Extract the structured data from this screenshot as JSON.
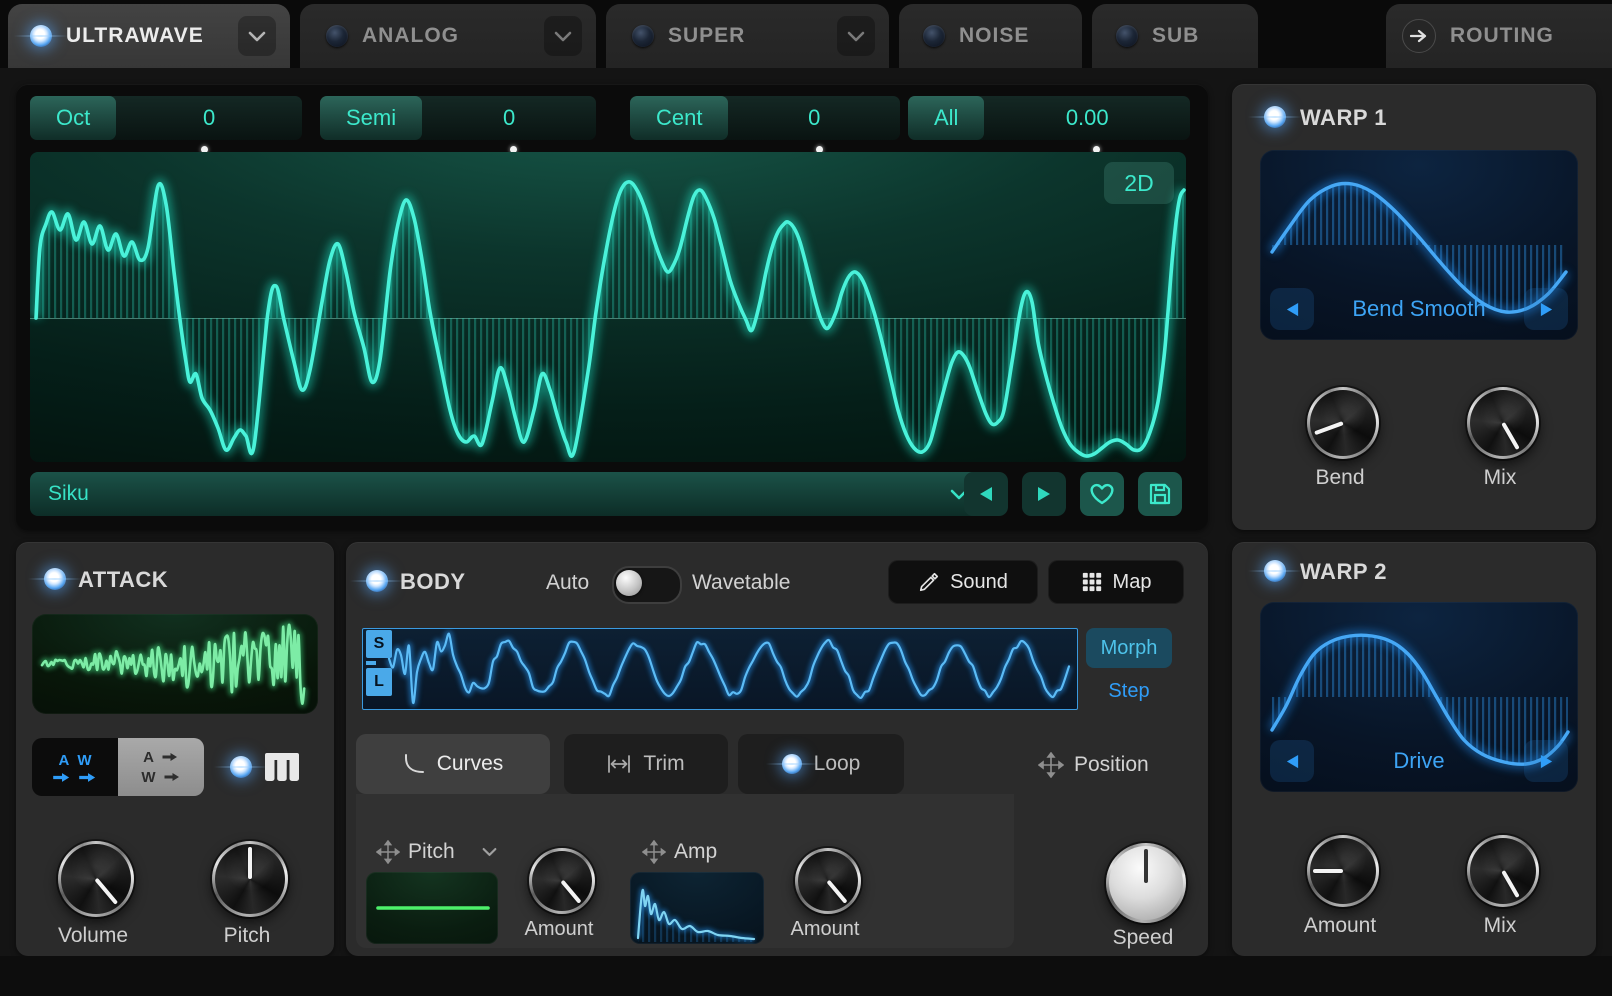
{
  "tabs": {
    "items": [
      {
        "label": "ULTRAWAVE",
        "active": true,
        "led": "on",
        "chevron": true
      },
      {
        "label": "ANALOG",
        "active": false,
        "led": "off",
        "chevron": true
      },
      {
        "label": "SUPER",
        "active": false,
        "led": "off",
        "chevron": true
      },
      {
        "label": "NOISE",
        "active": false,
        "led": "off",
        "chevron": false
      },
      {
        "label": "SUB",
        "active": false,
        "led": "off",
        "chevron": false
      }
    ],
    "routing_label": "ROUTING"
  },
  "oscillator": {
    "tune_controls": [
      {
        "label": "Oct",
        "value": "0"
      },
      {
        "label": "Semi",
        "value": "0"
      },
      {
        "label": "Cent",
        "value": "0"
      },
      {
        "label": "All",
        "value": "0.00"
      }
    ],
    "view_mode": "2D",
    "wavetable_name": "Siku"
  },
  "warp1": {
    "title": "WARP 1",
    "led": "on",
    "mode": "Bend Smooth",
    "knobs": [
      {
        "label": "Bend",
        "angle": -110
      },
      {
        "label": "Mix",
        "angle": 150
      }
    ]
  },
  "warp2": {
    "title": "WARP 2",
    "led": "on",
    "mode": "Drive",
    "knobs": [
      {
        "label": "Amount",
        "angle": -90
      },
      {
        "label": "Mix",
        "angle": 150
      }
    ]
  },
  "attack": {
    "title": "ATTACK",
    "led": "on",
    "keytrack_led": "on",
    "route_parallel": {
      "a": "A",
      "w": "W"
    },
    "route_serial": {
      "a": "A",
      "w": "W"
    },
    "knobs": [
      {
        "label": "Volume",
        "angle": 140
      },
      {
        "label": "Pitch",
        "angle": 0
      }
    ]
  },
  "body": {
    "title": "BODY",
    "led": "on",
    "auto_label": "Auto",
    "wavetable_label": "Wavetable",
    "sound_button": "Sound",
    "map_button": "Map",
    "sample_start": "S",
    "sample_loop": "L",
    "morph_button": "Morph",
    "step_button": "Step",
    "tabs": [
      {
        "label": "Curves",
        "active": true
      },
      {
        "label": "Trim",
        "active": false
      },
      {
        "label": "Loop",
        "active": false,
        "led": "on"
      }
    ],
    "position_label": "Position",
    "curves": {
      "pitch_label": "Pitch",
      "pitch_amount": {
        "label": "Amount",
        "angle": 140
      },
      "amp_label": "Amp",
      "amp_amount": {
        "label": "Amount",
        "angle": 140
      },
      "speed": {
        "label": "Speed",
        "angle": 0
      }
    }
  },
  "colors": {
    "teal": "#3ce8cb",
    "blue": "#2f9df8",
    "green": "#4df06a"
  }
}
